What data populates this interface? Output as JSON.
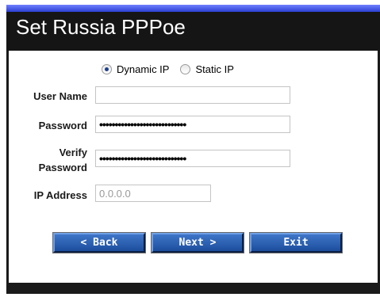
{
  "header": {
    "title": "Set Russia PPPoe"
  },
  "mode": {
    "options": [
      {
        "label": "Dynamic IP",
        "checked": true
      },
      {
        "label": "Static IP",
        "checked": false
      }
    ]
  },
  "form": {
    "user_name_label": "User Name",
    "user_name_value": "",
    "password_label": "Password",
    "password_mask": "••••••••••••••••••••••••••••",
    "verify_label_line1": "Verify",
    "verify_label_line2": "Password",
    "verify_mask": "••••••••••••••••••••••••••••",
    "ip_label": "IP Address",
    "ip_value": "0.0.0.0"
  },
  "buttons": {
    "back": "< Back",
    "next": "Next >",
    "exit": "Exit"
  },
  "colors": {
    "accent": "#2b3fd1",
    "button": "#2a5fb0",
    "frame": "#1a1a1a"
  }
}
